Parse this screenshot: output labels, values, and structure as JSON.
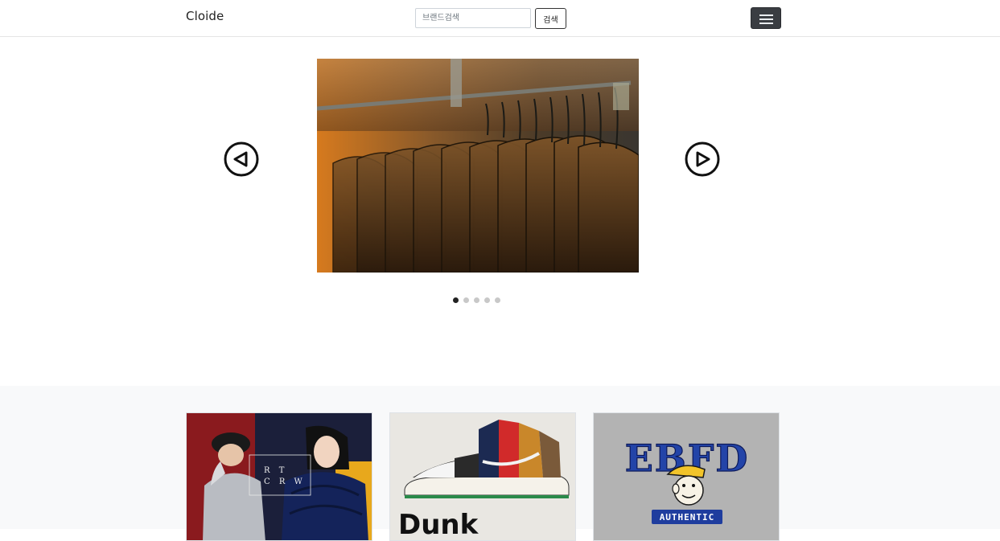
{
  "navbar": {
    "brand": "Cloide",
    "search_placeholder": "브랜드검색",
    "search_button": "검색",
    "menu_icon": "hamburger-icon"
  },
  "carousel": {
    "prev_icon": "arrow-left-circle-icon",
    "next_icon": "arrow-right-circle-icon",
    "slide_image": "clothing-rack-photo",
    "slide_count": 5,
    "active_index": 0
  },
  "cards": [
    {
      "image": "fashion-models-winter-jacket-photo",
      "overlay_text": [
        "R",
        "T",
        "C R W"
      ]
    },
    {
      "image": "nike-dunk-sneaker-photo",
      "overlay_text": [
        "Dunk"
      ]
    },
    {
      "image": "ebfd-authentic-logo-tshirt-photo",
      "overlay_text": [
        "EBFD",
        "AUTHENTIC"
      ]
    }
  ],
  "colors": {
    "navbar_bg": "#ffffff",
    "menu_button": "#3a3d42",
    "section_bg": "#f8f9fa",
    "dot_active": "#222222",
    "dot_inactive": "#c8c8c8"
  }
}
